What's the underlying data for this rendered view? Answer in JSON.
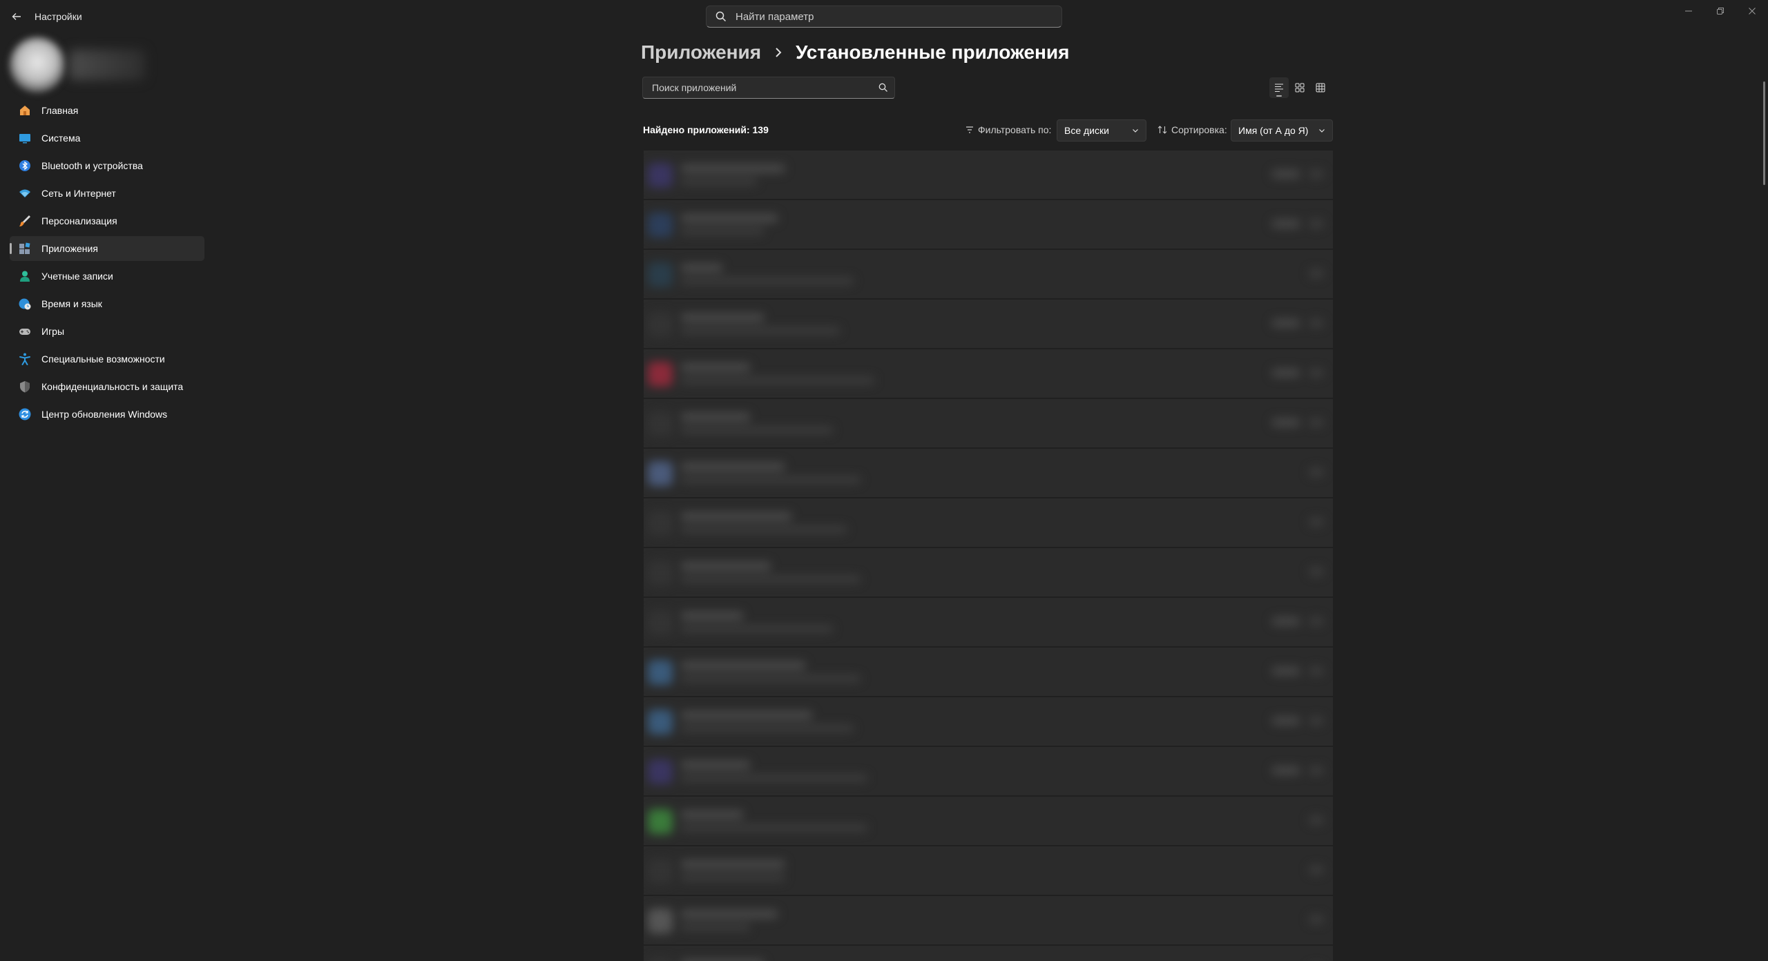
{
  "window": {
    "title": "Настройки",
    "search_placeholder": "Найти параметр"
  },
  "sidebar": {
    "items": [
      {
        "label": "Главная",
        "icon": "home-icon"
      },
      {
        "label": "Система",
        "icon": "system-icon"
      },
      {
        "label": "Bluetooth и устройства",
        "icon": "bluetooth-icon"
      },
      {
        "label": "Сеть и Интернет",
        "icon": "wifi-icon"
      },
      {
        "label": "Персонализация",
        "icon": "brush-icon"
      },
      {
        "label": "Приложения",
        "icon": "apps-icon",
        "active": true
      },
      {
        "label": "Учетные записи",
        "icon": "account-icon"
      },
      {
        "label": "Время и язык",
        "icon": "globe-clock-icon"
      },
      {
        "label": "Игры",
        "icon": "gamepad-icon"
      },
      {
        "label": "Специальные возможности",
        "icon": "accessibility-icon"
      },
      {
        "label": "Конфиденциальность и защита",
        "icon": "shield-icon"
      },
      {
        "label": "Центр обновления Windows",
        "icon": "update-icon"
      }
    ]
  },
  "main": {
    "breadcrumb": {
      "parent": "Приложения",
      "current": "Установленные приложения"
    },
    "app_search_placeholder": "Поиск приложений",
    "found_text": "Найдено приложений: 139",
    "filter": {
      "label": "Фильтровать по:",
      "value": "Все диски"
    },
    "sort": {
      "label": "Сортировка:",
      "value": "Имя (от А до Я)"
    },
    "view_modes": [
      "list-view",
      "tile-view",
      "grid-view"
    ],
    "active_view": "list-view"
  },
  "colors": {
    "background": "#202020",
    "card": "#2b2b2b",
    "accent_home": "#f0a04b",
    "accent_bluetooth": "#2f7fe0",
    "accent_wifi": "#3aa0e0"
  }
}
